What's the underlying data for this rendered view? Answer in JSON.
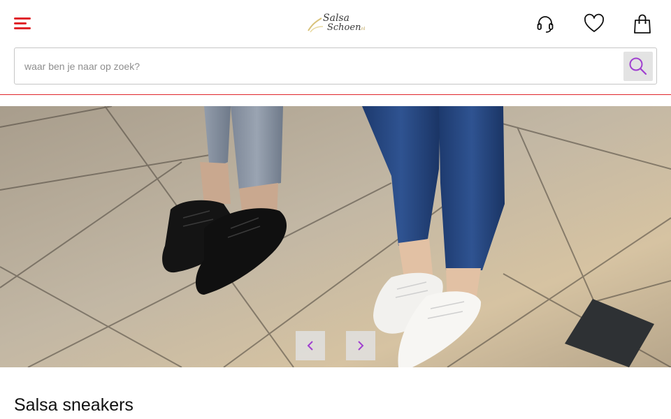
{
  "header": {
    "logo": {
      "line1": "Salsa",
      "line2": "Schoen",
      "suffix": ".nl"
    },
    "icons": [
      "menu-icon",
      "headset-icon",
      "heart-icon",
      "shopping-bag-icon"
    ],
    "accent_color": "#e0262b"
  },
  "search": {
    "placeholder": "waar ben je naar op zoek?",
    "value": "",
    "icon": "search-icon",
    "icon_color": "#a040d0"
  },
  "hero": {
    "image_description_icon": "hero-image",
    "prev_icon": "chevron-left-icon",
    "next_icon": "chevron-right-icon",
    "arrow_color": "#a040d0"
  },
  "main": {
    "title": "Salsa sneakers"
  }
}
